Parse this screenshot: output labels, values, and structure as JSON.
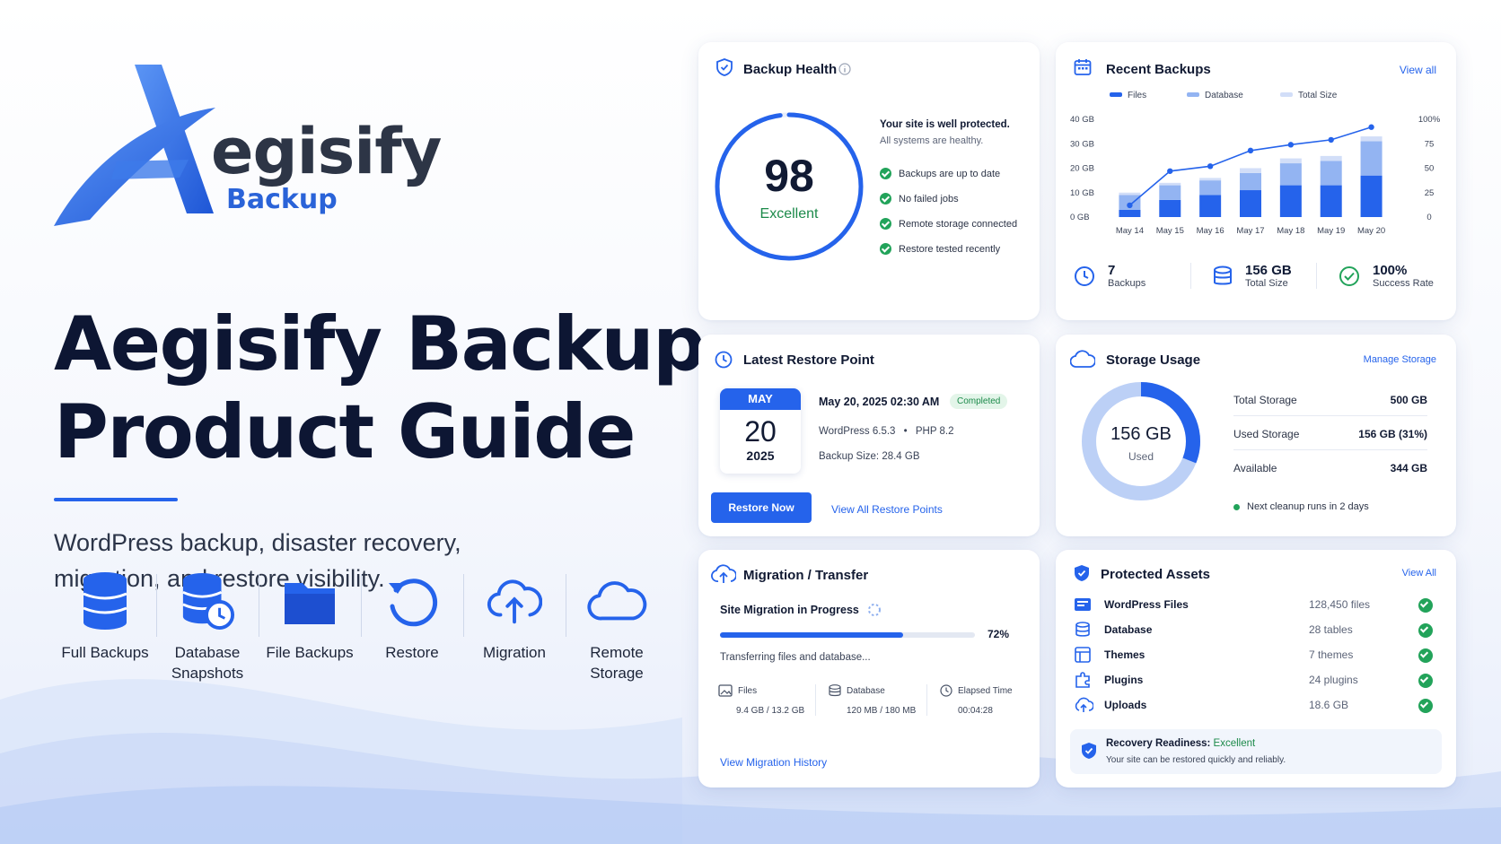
{
  "brand": {
    "logo_word": "egisify",
    "logo_sub": "Backup",
    "headline_line1": "Aegisify Backup",
    "headline_line2": "Product Guide",
    "tagline": "WordPress backup, disaster recovery, migration, and restore visibility."
  },
  "features": [
    {
      "icon": "database-icon",
      "label": "Full Backups"
    },
    {
      "icon": "database-clock-icon",
      "label": "Database Snapshots"
    },
    {
      "icon": "folder-icon",
      "label": "File Backups"
    },
    {
      "icon": "restore-icon",
      "label": "Restore"
    },
    {
      "icon": "cloud-upload-icon",
      "label": "Migration"
    },
    {
      "icon": "cloud-icon",
      "label": "Remote Storage"
    }
  ],
  "backup_health": {
    "title": "Backup Health",
    "score": "98",
    "score_value": 98,
    "rating": "Excellent",
    "status": "Your site is well protected.",
    "status_sub": "All systems are healthy.",
    "checks": [
      "Backups are up to date",
      "No failed jobs",
      "Remote storage connected",
      "Restore tested recently"
    ]
  },
  "recent_backups": {
    "title": "Recent Backups",
    "view_all": "View all",
    "stats": [
      {
        "icon": "clock-icon",
        "value": "7",
        "label": "Backups"
      },
      {
        "icon": "database-icon",
        "value": "156 GB",
        "label": "Total Size"
      },
      {
        "icon": "check-circle-icon",
        "value": "100%",
        "label": "Success Rate"
      }
    ]
  },
  "chart_data": {
    "type": "bar",
    "categories": [
      "May 14",
      "May 15",
      "May 16",
      "May 17",
      "May 18",
      "May 19",
      "May 20"
    ],
    "series": [
      {
        "name": "Files",
        "values": [
          3,
          7,
          9,
          11,
          13,
          13,
          17
        ],
        "color": "#2563eb"
      },
      {
        "name": "Database",
        "values": [
          6,
          6,
          6,
          7,
          9,
          10,
          14
        ],
        "color": "#93b4f2"
      },
      {
        "name": "Total Size",
        "values": [
          1,
          1,
          1,
          2,
          2,
          2,
          2
        ],
        "color": "#d2def8"
      }
    ],
    "line": {
      "name": "Success Rate",
      "values": [
        12,
        47,
        52,
        68,
        74,
        79,
        92
      ],
      "color": "#2563eb"
    },
    "yticks_left": [
      "40 GB",
      "30 GB",
      "20 GB",
      "10 GB",
      "0 GB"
    ],
    "yticks_right": [
      "100%",
      "75",
      "50",
      "25",
      "0"
    ],
    "ylim": [
      0,
      40
    ],
    "ylim_right": [
      0,
      100
    ]
  },
  "restore_point": {
    "title": "Latest Restore Point",
    "month": "MAY",
    "day": "20",
    "year": "2025",
    "datetime": "May 20, 2025 02:30 AM",
    "status": "Completed",
    "meta_wp": "WordPress 6.5.3",
    "meta_sep": "•",
    "meta_php": "PHP 8.2",
    "size": "Backup Size: 28.4 GB",
    "button": "Restore Now",
    "link": "View All Restore Points"
  },
  "storage": {
    "title": "Storage Usage",
    "manage": "Manage Storage",
    "used_value": "156 GB",
    "used_label": "Used",
    "used_fraction": 0.31,
    "rows": [
      {
        "k": "Total Storage",
        "v": "500 GB"
      },
      {
        "k": "Used Storage",
        "v": "156 GB (31%)"
      },
      {
        "k": "Available",
        "v": "344 GB"
      }
    ],
    "cleanup": "Next cleanup runs in 2 days",
    "colors": {
      "used": "#2563eb",
      "available": "#bcd0f6"
    }
  },
  "migration": {
    "title": "Migration / Transfer",
    "status": "Site Migration in Progress",
    "progress_value": 0.72,
    "progress": "72%",
    "detail": "Transferring files and database...",
    "stats": [
      {
        "icon": "image-file-icon",
        "label": "Files",
        "value": "9.4 GB / 13.2 GB"
      },
      {
        "icon": "database-icon",
        "label": "Database",
        "value": "120 MB / 180 MB"
      },
      {
        "icon": "clock-icon",
        "label": "Elapsed Time",
        "value": "00:04:28"
      }
    ],
    "link": "View Migration History"
  },
  "assets": {
    "title": "Protected Assets",
    "view_all": "View All",
    "rows": [
      {
        "icon": "wordpress-files-icon",
        "name": "WordPress Files",
        "count": "128,450 files"
      },
      {
        "icon": "database-icon",
        "name": "Database",
        "count": "28 tables"
      },
      {
        "icon": "themes-icon",
        "name": "Themes",
        "count": "7 themes"
      },
      {
        "icon": "plugins-icon",
        "name": "Plugins",
        "count": "24 plugins"
      },
      {
        "icon": "uploads-icon",
        "name": "Uploads",
        "count": "18.6 GB"
      }
    ],
    "ready_label": "Recovery Readiness:",
    "ready_value": "Excellent",
    "ready_sub": "Your site can be restored quickly and reliably."
  }
}
